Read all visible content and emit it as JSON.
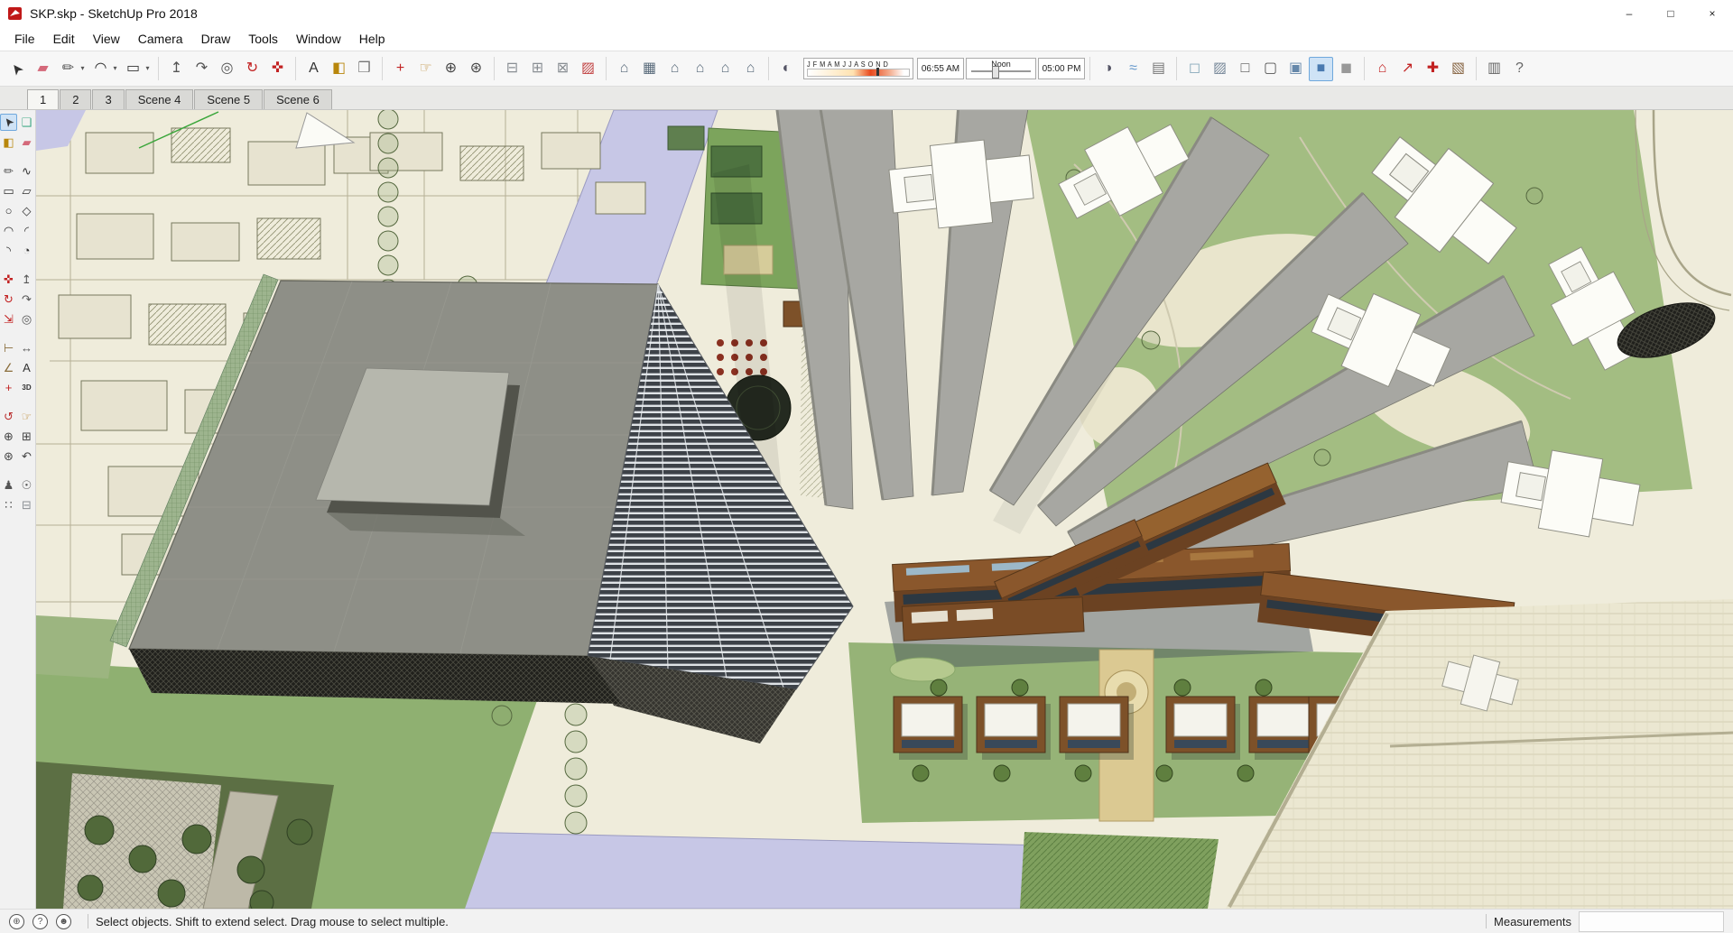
{
  "window": {
    "title": "SKP.skp - SketchUp Pro 2018",
    "controls": [
      {
        "name": "minimize-button",
        "glyph": "–"
      },
      {
        "name": "restore-button",
        "glyph": "□"
      },
      {
        "name": "close-button",
        "glyph": "×"
      }
    ]
  },
  "menu": {
    "items": [
      {
        "name": "menu-file",
        "label": "File"
      },
      {
        "name": "menu-edit",
        "label": "Edit"
      },
      {
        "name": "menu-view",
        "label": "View"
      },
      {
        "name": "menu-camera",
        "label": "Camera"
      },
      {
        "name": "menu-draw",
        "label": "Draw"
      },
      {
        "name": "menu-tools",
        "label": "Tools"
      },
      {
        "name": "menu-window",
        "label": "Window"
      },
      {
        "name": "menu-help",
        "label": "Help"
      }
    ]
  },
  "toolbar": {
    "groups": {
      "g1": [
        {
          "name": "select-tool-icon",
          "glyph": "➤",
          "cls": "rot-nw"
        },
        {
          "name": "eraser-tool-icon",
          "glyph": "▰",
          "color": "#d4697a"
        },
        {
          "name": "line-tool-icon",
          "glyph": "✏",
          "color": "#555555"
        },
        {
          "name": "line-dropdown",
          "glyph": "▾",
          "cls": "dd"
        },
        {
          "name": "arc-tool-icon",
          "glyph": "◠",
          "color": "#333333"
        },
        {
          "name": "arc-dropdown",
          "glyph": "▾",
          "cls": "dd"
        },
        {
          "name": "shapes-tool-icon",
          "glyph": "▭",
          "color": "#333333"
        },
        {
          "name": "shapes-dropdown",
          "glyph": "▾",
          "cls": "dd"
        }
      ],
      "g2": [
        {
          "name": "push-pull-icon",
          "glyph": "↥",
          "color": "#555555"
        },
        {
          "name": "follow-me-icon",
          "glyph": "↷",
          "color": "#555555"
        },
        {
          "name": "offset-icon",
          "glyph": "◎",
          "color": "#555555"
        },
        {
          "name": "rotate-icon",
          "glyph": "↻",
          "color": "#c22222"
        },
        {
          "name": "move-icon",
          "glyph": "✜",
          "color": "#c22222"
        }
      ],
      "g3": [
        {
          "name": "text-tool-icon",
          "glyph": "A",
          "color": "#333333"
        },
        {
          "name": "paint-bucket-icon",
          "glyph": "◧",
          "color": "#b8860b"
        },
        {
          "name": "material-sample-icon",
          "glyph": "❒",
          "color": "#777777"
        }
      ],
      "g4": [
        {
          "name": "axes-icon",
          "glyph": "+",
          "color": "#c22222"
        },
        {
          "name": "pan-icon",
          "glyph": "☞",
          "color": "#c09040"
        },
        {
          "name": "zoom-icon",
          "glyph": "⊕",
          "color": "#444444"
        },
        {
          "name": "zoom-extents-icon",
          "glyph": "⊛",
          "color": "#444444"
        }
      ],
      "g5": [
        {
          "name": "section-plane-icon",
          "glyph": "⊟",
          "color": "#8a8f94"
        },
        {
          "name": "display-section-planes-icon",
          "glyph": "⊞",
          "color": "#8a8f94"
        },
        {
          "name": "display-section-cuts-icon",
          "glyph": "⊠",
          "color": "#8a8f94"
        },
        {
          "name": "back-edges-icon",
          "glyph": "▨",
          "color": "#c24444"
        }
      ],
      "g6": [
        {
          "name": "view-iso-icon",
          "glyph": "⌂",
          "color": "#5b6c7c"
        },
        {
          "name": "view-top-icon",
          "glyph": "▦",
          "color": "#5b6c7c"
        },
        {
          "name": "view-front-icon",
          "glyph": "⌂",
          "color": "#5b6c7c"
        },
        {
          "name": "view-right-icon",
          "glyph": "⌂",
          "color": "#5b6c7c"
        },
        {
          "name": "view-back-icon",
          "glyph": "⌂",
          "color": "#5b6c7c"
        },
        {
          "name": "view-left-icon",
          "glyph": "⌂",
          "color": "#5b6c7c"
        }
      ],
      "g7": [
        {
          "name": "shadow-settings-icon",
          "glyph": "◐",
          "color": "#556"
        }
      ],
      "g8": [
        {
          "name": "shadows-toggle-icon",
          "glyph": "◑",
          "color": "#556"
        },
        {
          "name": "fog-toggle-icon",
          "glyph": "≈",
          "color": "#6699cc"
        },
        {
          "name": "match-photo-icon",
          "glyph": "▤",
          "color": "#777777"
        }
      ],
      "g9": [
        {
          "name": "style-xray-icon",
          "glyph": "◻",
          "color": "#88aabb"
        },
        {
          "name": "style-back-edges-icon",
          "glyph": "▨",
          "color": "#778899"
        },
        {
          "name": "style-wireframe-icon",
          "glyph": "□",
          "color": "#555555"
        },
        {
          "name": "style-hidden-line-icon",
          "glyph": "▢",
          "color": "#555555"
        },
        {
          "name": "style-shaded-icon",
          "glyph": "▣",
          "color": "#6688aa"
        },
        {
          "name": "style-shaded-textures-icon",
          "glyph": "■",
          "color": "#4a7ab0",
          "cls": "active"
        },
        {
          "name": "style-monochrome-icon",
          "glyph": "◼",
          "color": "#999999"
        }
      ],
      "g10": [
        {
          "name": "warehouse-icon",
          "glyph": "⌂",
          "color": "#c22222"
        },
        {
          "name": "share-model-icon",
          "glyph": "↗",
          "color": "#c22222"
        },
        {
          "name": "extension-warehouse-icon",
          "glyph": "✚",
          "color": "#c22222"
        },
        {
          "name": "send-to-layout-icon",
          "glyph": "▧",
          "color": "#886644"
        }
      ],
      "g11": [
        {
          "name": "default-tray-icon",
          "glyph": "▥",
          "color": "#666666"
        },
        {
          "name": "instructor-icon",
          "glyph": "?",
          "color": "#666666"
        }
      ]
    },
    "shadow": {
      "months": "J F M A M J J A S O N D",
      "time_start": "06:55 AM",
      "time_noon": "Noon",
      "time_end": "05:00 PM"
    }
  },
  "scene_tabs": {
    "tabs": [
      {
        "name": "scene-tab-1",
        "label": "1",
        "cls": "active"
      },
      {
        "name": "scene-tab-2",
        "label": "2"
      },
      {
        "name": "scene-tab-3",
        "label": "3"
      },
      {
        "name": "scene-tab-4",
        "label": "Scene 4"
      },
      {
        "name": "scene-tab-5",
        "label": "Scene 5"
      },
      {
        "name": "scene-tab-6",
        "label": "Scene 6"
      }
    ]
  },
  "tools": {
    "items": [
      {
        "name": "tool-select",
        "glyph": "➤",
        "cls": "rot-nw active"
      },
      {
        "name": "tool-make-component",
        "glyph": "❑",
        "color": "#44aa88"
      },
      {
        "name": "tool-paint-bucket",
        "glyph": "◧",
        "color": "#b8860b"
      },
      {
        "name": "tool-eraser",
        "glyph": "▰",
        "color": "#d4697a"
      },
      {
        "name": "palette-separator",
        "glyph": "",
        "cls": "spacer",
        "interactable": false
      },
      {
        "name": "tool-line",
        "glyph": "✏",
        "color": "#555555"
      },
      {
        "name": "tool-freehand",
        "glyph": "∿",
        "color": "#333333"
      },
      {
        "name": "tool-rectangle",
        "glyph": "▭",
        "color": "#333333"
      },
      {
        "name": "tool-rotated-rectangle",
        "glyph": "▱",
        "color": "#333333"
      },
      {
        "name": "tool-circle",
        "glyph": "○",
        "color": "#333333"
      },
      {
        "name": "tool-polygon",
        "glyph": "◇",
        "color": "#333333"
      },
      {
        "name": "tool-2pt-arc",
        "glyph": "◠",
        "color": "#333333"
      },
      {
        "name": "tool-arc",
        "glyph": "◜",
        "color": "#333333"
      },
      {
        "name": "tool-3pt-arc",
        "glyph": "◝",
        "color": "#333333"
      },
      {
        "name": "tool-pie",
        "glyph": "◔",
        "color": "#333333"
      },
      {
        "name": "palette-separator",
        "glyph": "",
        "cls": "spacer",
        "interactable": false
      },
      {
        "name": "tool-move",
        "glyph": "✜",
        "color": "#c22222"
      },
      {
        "name": "tool-push-pull",
        "glyph": "↥",
        "color": "#555555"
      },
      {
        "name": "tool-rotate",
        "glyph": "↻",
        "color": "#c22222"
      },
      {
        "name": "tool-follow-me",
        "glyph": "↷",
        "color": "#555555"
      },
      {
        "name": "tool-scale",
        "glyph": "⇲",
        "color": "#c22222"
      },
      {
        "name": "tool-offset",
        "glyph": "◎",
        "color": "#555555"
      },
      {
        "name": "palette-separator",
        "glyph": "",
        "cls": "spacer",
        "interactable": false
      },
      {
        "name": "tool-tape-measure",
        "glyph": "⊢",
        "color": "#8a6d3b"
      },
      {
        "name": "tool-dimension",
        "glyph": "↔",
        "color": "#555555"
      },
      {
        "name": "tool-protractor",
        "glyph": "∠",
        "color": "#8a6d3b"
      },
      {
        "name": "tool-text",
        "glyph": "A",
        "color": "#333333"
      },
      {
        "name": "tool-axes",
        "glyph": "+",
        "color": "#c22222"
      },
      {
        "name": "tool-3d-text",
        "glyph": "3D",
        "cls": "txt",
        "color": "#333333"
      },
      {
        "name": "palette-separator",
        "glyph": "",
        "cls": "spacer",
        "interactable": false
      },
      {
        "name": "tool-orbit",
        "glyph": "↺",
        "color": "#bb3333"
      },
      {
        "name": "tool-pan",
        "glyph": "☞",
        "color": "#c09040"
      },
      {
        "name": "tool-zoom",
        "glyph": "⊕",
        "color": "#444444"
      },
      {
        "name": "tool-zoom-window",
        "glyph": "⊞",
        "color": "#444444"
      },
      {
        "name": "tool-zoom-extents",
        "glyph": "⊛",
        "color": "#444444"
      },
      {
        "name": "tool-previous",
        "glyph": "↶",
        "color": "#444444"
      },
      {
        "name": "palette-separator",
        "glyph": "",
        "cls": "spacer",
        "interactable": false
      },
      {
        "name": "tool-position-camera",
        "glyph": "♟",
        "color": "#555555"
      },
      {
        "name": "tool-look-around",
        "glyph": "☉",
        "color": "#555555"
      },
      {
        "name": "tool-walk",
        "glyph": "∷",
        "color": "#555555"
      },
      {
        "name": "tool-section-plane",
        "glyph": "⊟",
        "color": "#8a8f94"
      }
    ]
  },
  "statusbar": {
    "icons": [
      {
        "name": "geolocation-icon",
        "glyph": "⊕"
      },
      {
        "name": "help-icon",
        "glyph": "?"
      },
      {
        "name": "account-icon",
        "glyph": "☻"
      }
    ],
    "hint": "Select objects. Shift to extend select. Drag mouse to select multiple.",
    "measurements_label": "Measurements",
    "measurements_value": ""
  },
  "palette": {
    "canvas_background": "#efecdb",
    "road_lavender": "#c7c7e6",
    "green_light": "#9cb580",
    "green_dark": "#5c6f44",
    "building_roof_gray": "#8e8f87",
    "tower_gray": "#a7a7a2",
    "tower_footprint_white": "#fcfcf7",
    "copper_brown": "#8a572c",
    "glass_dark": "#3d4248",
    "selection_highlight": "#cfe3f6"
  }
}
